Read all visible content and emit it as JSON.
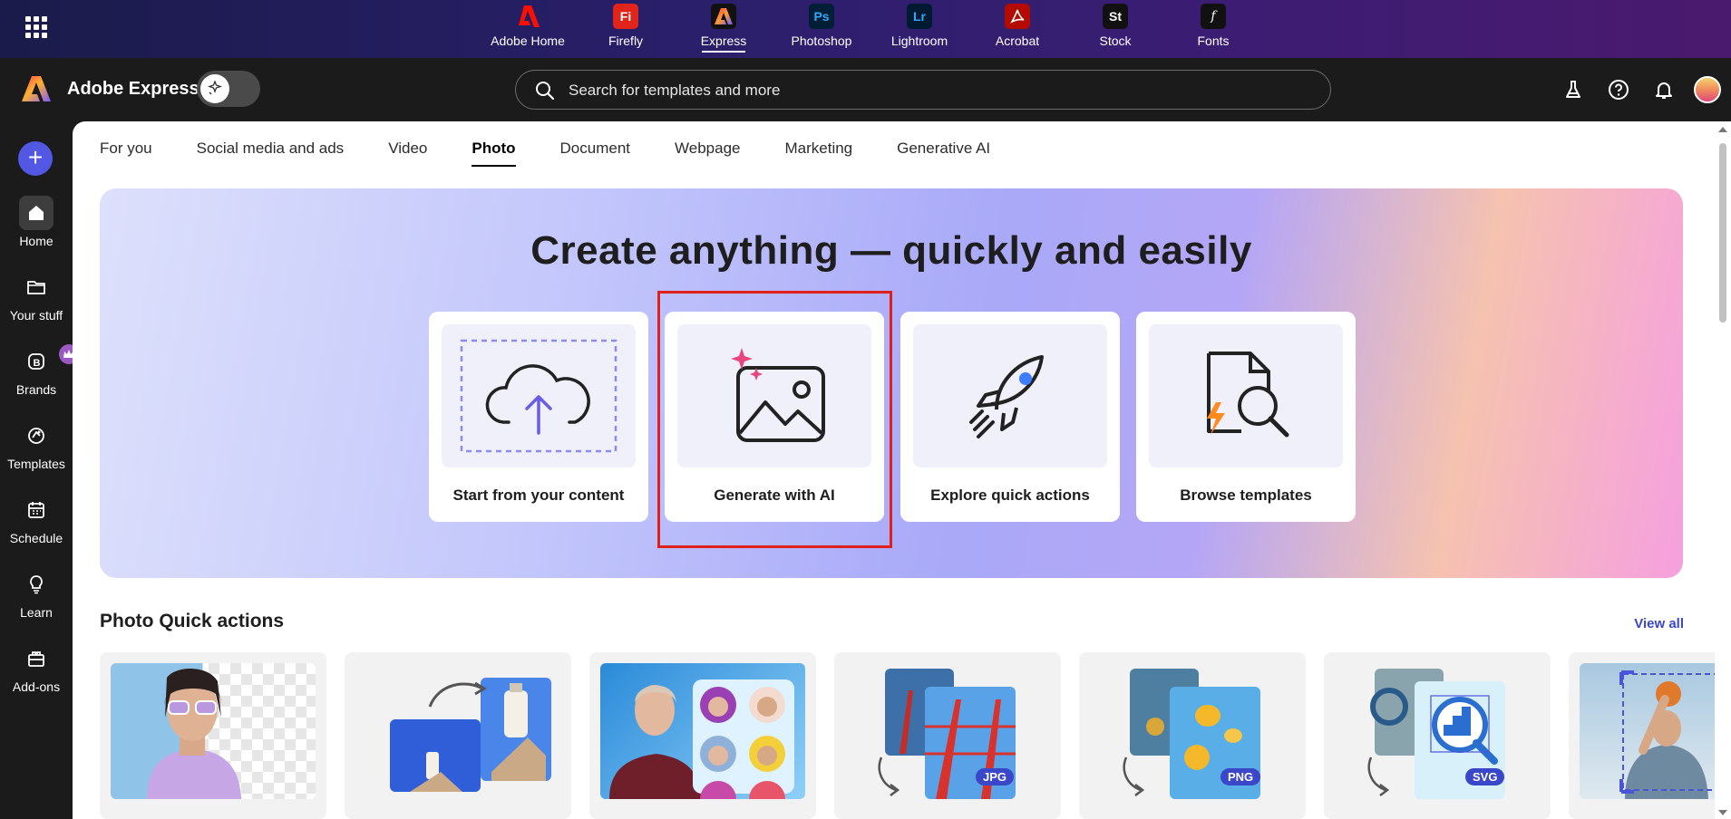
{
  "app_switcher": {
    "apps": [
      {
        "label": "Adobe Home",
        "glyph": "A",
        "color": "#1b1b1b",
        "active": false
      },
      {
        "label": "Firefly",
        "glyph": "Fi",
        "color": "#e1251b",
        "active": false
      },
      {
        "label": "Express",
        "glyph": "",
        "color": "#111111",
        "active": true
      },
      {
        "label": "Photoshop",
        "glyph": "Ps",
        "color": "#001e36",
        "active": false
      },
      {
        "label": "Lightroom",
        "glyph": "Lr",
        "color": "#001a32",
        "active": false
      },
      {
        "label": "Acrobat",
        "glyph": "",
        "color": "#b30b00",
        "active": false
      },
      {
        "label": "Stock",
        "glyph": "St",
        "color": "#111111",
        "active": false
      },
      {
        "label": "Fonts",
        "glyph": "f",
        "color": "#111111",
        "active": false
      }
    ]
  },
  "header": {
    "brand": "Adobe Express",
    "search_placeholder": "Search for templates and more",
    "icons": [
      "labs-flask-icon",
      "help-icon",
      "notifications-bell-icon",
      "user-avatar"
    ]
  },
  "rail": {
    "items": [
      {
        "label": "Home",
        "icon": "home-icon",
        "active": true
      },
      {
        "label": "Your stuff",
        "icon": "folder-icon",
        "active": false
      },
      {
        "label": "Brands",
        "icon": "brands-icon",
        "active": false
      },
      {
        "label": "Templates",
        "icon": "templates-icon",
        "active": false
      },
      {
        "label": "Schedule",
        "icon": "calendar-icon",
        "active": false
      },
      {
        "label": "Learn",
        "icon": "lightbulb-icon",
        "active": false
      },
      {
        "label": "Add-ons",
        "icon": "addons-icon",
        "active": false
      }
    ]
  },
  "tabs": [
    "For you",
    "Social media and ads",
    "Video",
    "Photo",
    "Document",
    "Webpage",
    "Marketing",
    "Generative AI"
  ],
  "active_tab": "Photo",
  "hero": {
    "title": "Create anything — quickly and easily",
    "cards": [
      {
        "label": "Start from your content",
        "icon": "upload-cloud-icon"
      },
      {
        "label": "Generate with AI",
        "icon": "ai-image-sparkle-icon",
        "highlighted": true
      },
      {
        "label": "Explore quick actions",
        "icon": "rocket-icon"
      },
      {
        "label": "Browse templates",
        "icon": "template-search-icon"
      }
    ]
  },
  "quick_actions": {
    "title": "Photo Quick actions",
    "view_all": "View all",
    "badges": {
      "jpg": "JPG",
      "png": "PNG",
      "svg": "SVG"
    }
  },
  "colors": {
    "accent": "#5258e4",
    "highlight": "#e0201c",
    "link": "#3a47c8"
  }
}
